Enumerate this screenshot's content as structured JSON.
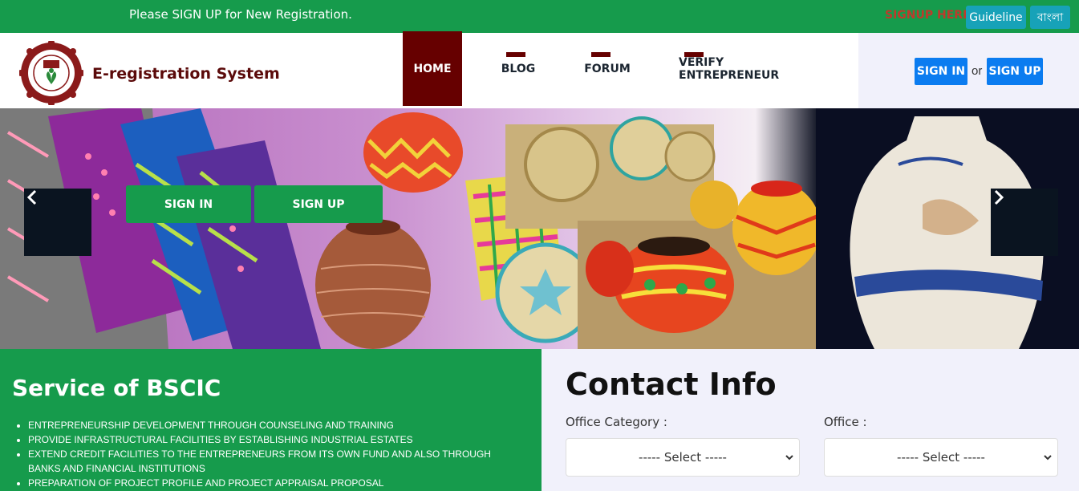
{
  "topbar": {
    "notice": "Please SIGN UP for New Registration.",
    "signup_here": "SIGNUP HERE",
    "guideline": "Guideline",
    "bangla": "বাংলা"
  },
  "header": {
    "brand": "E-registration System",
    "logo_icon": "bscic-logo-icon",
    "nav": {
      "home": "HOME",
      "blog": "BLOG",
      "forum": "FORUM",
      "verify": "VERIFY ENTREPRENEUR"
    },
    "sign_in": "SIGN IN",
    "or": "or",
    "sign_up": "SIGN UP"
  },
  "hero": {
    "sign_in": "SIGN IN",
    "sign_up": "SIGN UP"
  },
  "service": {
    "title": "Service of BSCIC",
    "items": [
      "ENTREPRENEURSHIP DEVELOPMENT THROUGH COUNSELING AND TRAINING",
      "PROVIDE INFRASTRUCTURAL FACILITIES BY ESTABLISHING INDUSTRIAL ESTATES",
      "EXTEND CREDIT FACILITIES TO THE ENTREPRENEURS FROM ITS OWN FUND AND ALSO THROUGH BANKS AND FINANCIAL INSTITUTIONS",
      "PREPARATION OF PROJECT PROFILE AND PROJECT APPRAISAL PROPOSAL"
    ]
  },
  "contact": {
    "title": "Contact Info",
    "office_category_label": "Office Category :",
    "office_label": "Office :",
    "office_category_value": "----- Select -----",
    "office_value": "----- Select -----"
  },
  "colors": {
    "green": "#169b4c",
    "maroon": "#660000",
    "blue": "#0b7cf0",
    "teal": "#17a2b8"
  }
}
